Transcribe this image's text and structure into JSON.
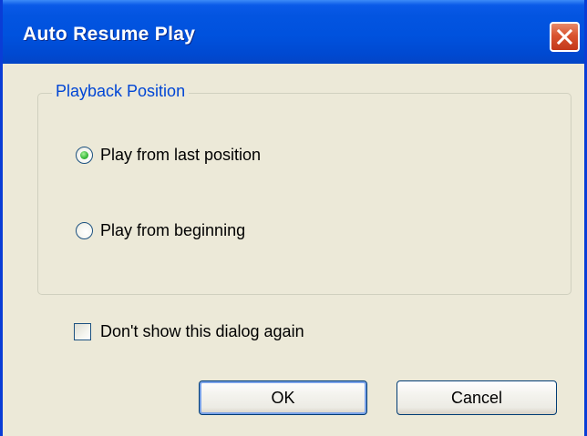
{
  "window": {
    "title": "Auto Resume Play",
    "close_icon": "close-icon"
  },
  "playback_group": {
    "legend": "Playback Position",
    "options": [
      {
        "label": "Play from last position",
        "checked": true
      },
      {
        "label": "Play from beginning",
        "checked": false
      }
    ]
  },
  "dont_show": {
    "label": "Don't show this dialog again",
    "checked": false
  },
  "buttons": {
    "ok_label": "OK",
    "cancel_label": "Cancel"
  },
  "colors": {
    "title_bar": "#0052de",
    "dialog_background": "#ece9d8",
    "group_legend_text": "#0046d5",
    "close_button": "#d9532f",
    "radio_selected": "#3fbd3f"
  }
}
